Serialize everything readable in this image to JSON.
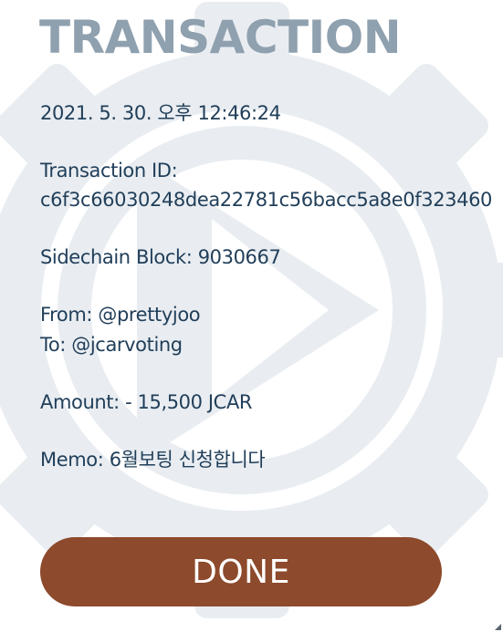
{
  "title": "TRANSACTION",
  "timestamp": "2021. 5. 30. 오후 12:46:24",
  "transaction_id_label": "Transaction ID:",
  "transaction_id": "c6f3c66030248dea22781c56bacc5a8e0f323460",
  "sidechain_block": "Sidechain Block: 9030667",
  "from": "From: @prettyjoo",
  "to": "To: @jcarvoting",
  "amount": "Amount: - 15,500 JCAR",
  "memo": "Memo: 6월보팅 신청합니다",
  "done_label": "DONE",
  "icons": {
    "watermark": "gear-play-logo-icon",
    "resize": "resize-grip-icon"
  },
  "colors": {
    "title": "#8fa0af",
    "text": "#213f5a",
    "button": "#8d4a2c",
    "watermark": "#e9edf1"
  }
}
